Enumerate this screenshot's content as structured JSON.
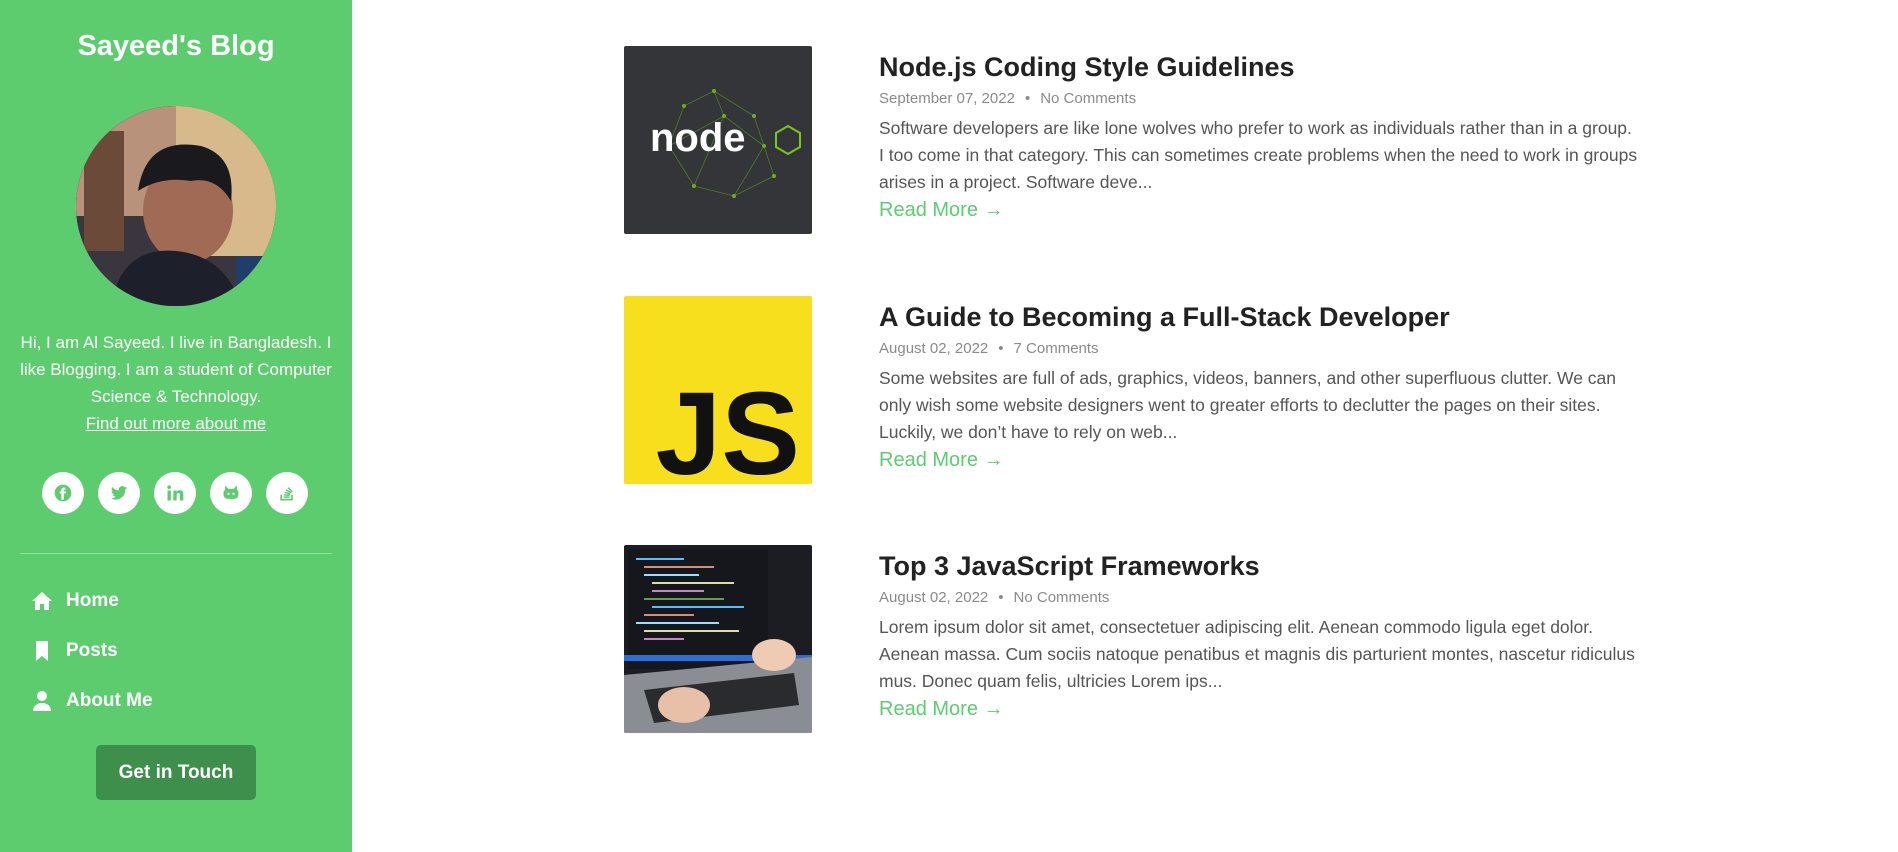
{
  "sidebar": {
    "blog_title": "Sayeed's Blog",
    "bio": "Hi, I am Al Sayeed. I live in Bangladesh. I like Blogging. I am a student of Computer Science & Technology.",
    "bio_link": "Find out more about me",
    "socials": [
      "facebook-icon",
      "twitter-icon",
      "linkedin-icon",
      "github-icon",
      "stackoverflow-icon"
    ],
    "nav": [
      {
        "label": "Home",
        "icon": "home-icon"
      },
      {
        "label": "Posts",
        "icon": "bookmark-icon"
      },
      {
        "label": "About Me",
        "icon": "user-icon"
      }
    ],
    "cta": "Get in Touch"
  },
  "posts": [
    {
      "title": "Node.js Coding Style Guidelines",
      "date": "September 07, 2022",
      "comments": "No Comments",
      "excerpt": "Software developers are like lone wolves who prefer to work as individuals rather than in a group. I too come in that category. This can sometimes create problems when the need to work in groups arises in a project. Software deve...",
      "read_more": "Read More →",
      "thumb_text": "node"
    },
    {
      "title": "A Guide to Becoming a Full-Stack Developer",
      "date": "August 02, 2022",
      "comments": "7 Comments",
      "excerpt": "Some websites are full of ads, graphics, videos, banners, and other superfluous clutter. We can only wish some website designers went to greater efforts to declutter the pages on their sites. Luckily, we don’t have to rely on web...",
      "read_more": "Read More →",
      "thumb_text": "JS"
    },
    {
      "title": "Top 3 JavaScript Frameworks",
      "date": "August 02, 2022",
      "comments": "No Comments",
      "excerpt": "Lorem ipsum dolor sit amet, consectetuer adipiscing elit. Aenean commodo ligula eget dolor. Aenean massa. Cum sociis natoque penatibus et magnis dis parturient montes, nascetur ridiculus mus. Donec quam felis, ultricies Lorem ips...",
      "read_more": "Read More →"
    }
  ],
  "colors": {
    "accent": "#5dcc6e",
    "cta": "#3f8f4c",
    "js_yellow": "#f7df1e"
  }
}
